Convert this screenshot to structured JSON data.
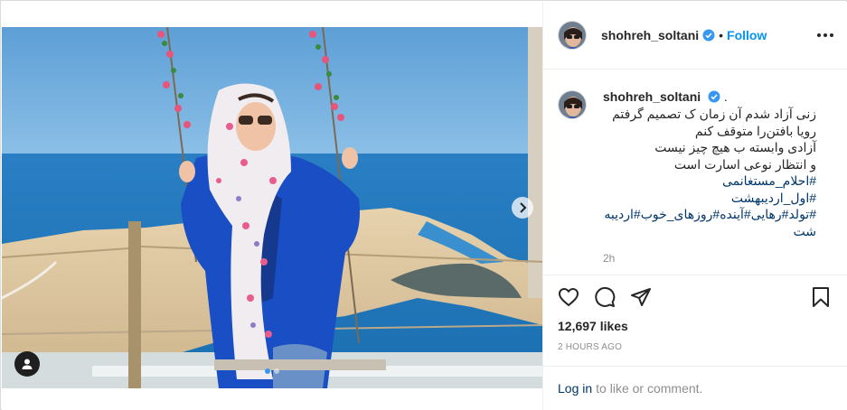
{
  "post": {
    "username": "shohreh_soltani",
    "follow_label": "Follow",
    "separator": "•"
  },
  "caption": {
    "username": "shohreh_soltani",
    "suffix": ".",
    "lines": [
      "زنی آزاد شدم آن زمان ک تصمیم گرفتم",
      "رویا بافتن‌را متوقف کنم",
      "آزادی وابسته ب هیچ چیز نیست",
      "و انتظار نوعی اسارت است"
    ],
    "hashtags": [
      "#احلام_مستغانمی",
      "#اول_اردیبهشت",
      "#تولد#رهایی#آینده#روزهای_خوب#اردیبه",
      "شت"
    ],
    "age": "2h"
  },
  "stats": {
    "likes": "12,697 likes",
    "posted": "2 HOURS AGO"
  },
  "footer": {
    "login_link": "Log in",
    "login_text": "to like or comment."
  },
  "colors": {
    "accent": "#0095f6",
    "hashtag": "#00376b",
    "verified": "#3897f0",
    "muted": "#8e8e8e"
  },
  "icons": {
    "options": "more-options-icon",
    "verified": "verified-badge-icon",
    "like": "heart-icon",
    "comment": "comment-icon",
    "share": "paper-plane-icon",
    "save": "bookmark-icon",
    "next": "chevron-right-icon",
    "tag": "user-tag-icon"
  },
  "carousel": {
    "slides": 2,
    "active": 0
  }
}
